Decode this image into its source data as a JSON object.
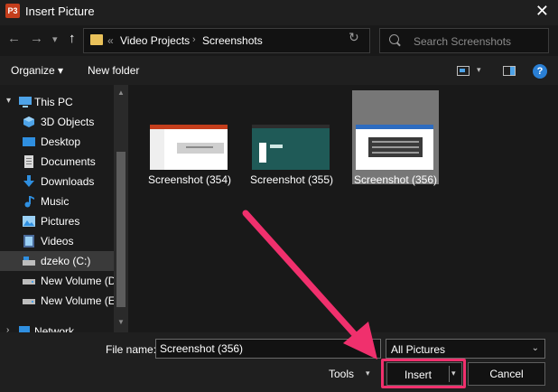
{
  "window": {
    "title": "Insert Picture",
    "app_icon": "P3",
    "close_glyph": "✕"
  },
  "nav": {
    "back": "←",
    "forward": "→",
    "recent": "▾",
    "up": "↑"
  },
  "address": {
    "prefix": "«",
    "crumbs": [
      "Video Projects",
      "Screenshots"
    ],
    "separator": "›",
    "dropdown": "▾",
    "refresh": "↻"
  },
  "search": {
    "placeholder": "Search Screenshots"
  },
  "toolbar": {
    "organize": "Organize ▾",
    "new_folder": "New folder",
    "view_dropdown": "▾",
    "help": "?"
  },
  "sidebar": {
    "items": [
      {
        "label": "This PC",
        "icon": "pc-icon",
        "caret": "▾"
      },
      {
        "label": "3D Objects",
        "icon": "3d-objects-icon",
        "caret": ""
      },
      {
        "label": "Desktop",
        "icon": "desktop-icon",
        "caret": ""
      },
      {
        "label": "Documents",
        "icon": "documents-icon",
        "caret": ""
      },
      {
        "label": "Downloads",
        "icon": "downloads-icon",
        "caret": ""
      },
      {
        "label": "Music",
        "icon": "music-icon",
        "caret": ""
      },
      {
        "label": "Pictures",
        "icon": "pictures-icon",
        "caret": ""
      },
      {
        "label": "Videos",
        "icon": "videos-icon",
        "caret": ""
      },
      {
        "label": "dzeko (C:)",
        "icon": "drive-icon",
        "caret": ""
      },
      {
        "label": "New Volume (D:",
        "icon": "drive-icon",
        "caret": ""
      },
      {
        "label": "New Volume (E:)",
        "icon": "drive-icon",
        "caret": ""
      },
      {
        "label": "Network",
        "icon": "network-icon",
        "caret": "›"
      }
    ],
    "selected": "dzeko (C:)",
    "scroll_up": "▲",
    "scroll_down": "▼"
  },
  "files": [
    {
      "name": "Screenshot (354)",
      "selected": false
    },
    {
      "name": "Screenshot (355)",
      "selected": false
    },
    {
      "name": "Screenshot (356)",
      "selected": true
    }
  ],
  "footer": {
    "filename_label": "File name:",
    "filename_value": "Screenshot (356)",
    "filetype": "All Pictures",
    "filetype_chevron": "⌄",
    "tools": "Tools",
    "tools_dd": "▾",
    "insert": "Insert",
    "insert_dd": "▾",
    "cancel": "Cancel"
  },
  "colors": {
    "accent_highlight": "#f0306d",
    "folder": "#e9c15a",
    "brand": "#c43e1c"
  }
}
